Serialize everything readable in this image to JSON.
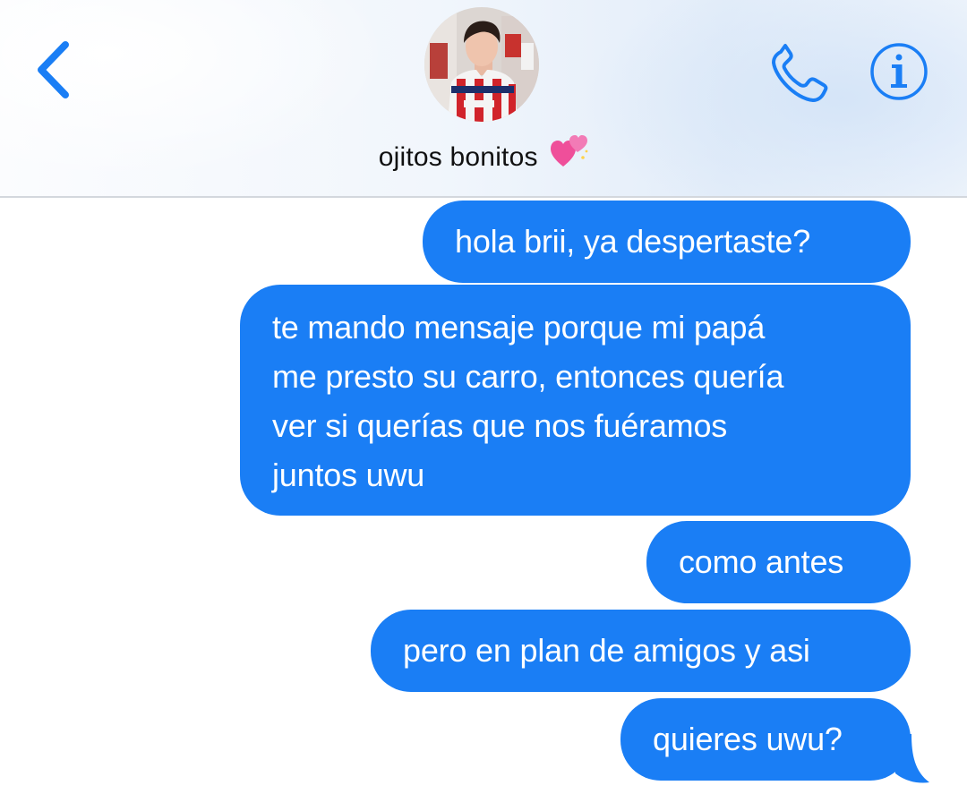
{
  "header": {
    "contact_name": "ojitos bonitos",
    "contact_emoji": "heart-emoji",
    "back_icon": "chevron-left-icon",
    "call_icon": "phone-icon",
    "info_icon": "info-icon",
    "avatar_icon": "contact-avatar-photo"
  },
  "colors": {
    "accent": "#1a7ef5",
    "bubble_text": "#ffffff",
    "header_border": "#d3d7dd"
  },
  "messages": [
    {
      "sender": "me",
      "lines": [
        "hola brii, ya despertaste?"
      ]
    },
    {
      "sender": "me",
      "lines": [
        "te mando mensaje porque mi papá",
        "me presto su carro, entonces quería",
        "ver si querías que nos fuéramos",
        "juntos uwu"
      ]
    },
    {
      "sender": "me",
      "lines": [
        "como antes"
      ]
    },
    {
      "sender": "me",
      "lines": [
        "pero en plan de amigos y asi"
      ]
    },
    {
      "sender": "me",
      "lines": [
        "quieres uwu?"
      ]
    }
  ]
}
